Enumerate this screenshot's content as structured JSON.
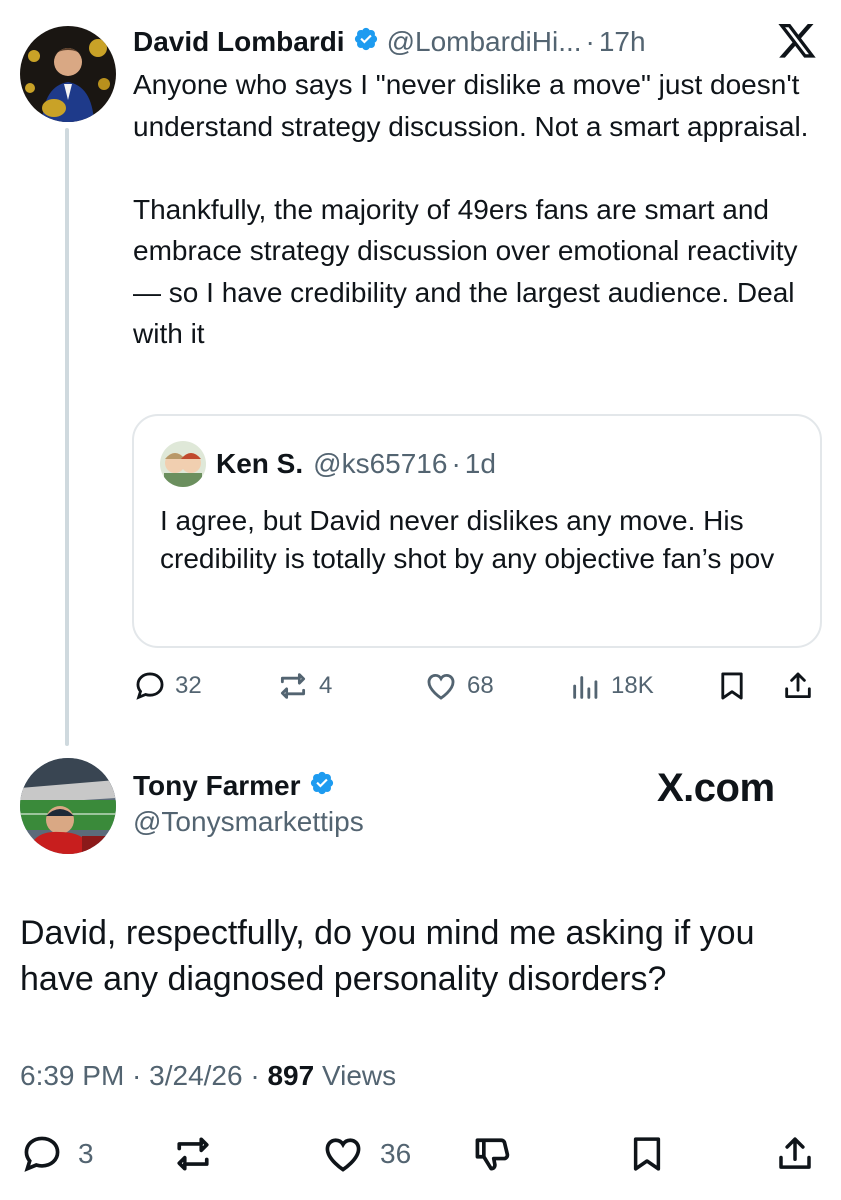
{
  "post1": {
    "author_name": "David Lombardi",
    "handle": "@LombardiHi...",
    "time": "17h",
    "paragraphs": [
      "Anyone who says I \"never dislike a move\" just doesn't understand strategy discussion. Not a smart appraisal.",
      "Thankfully, the majority of 49ers fans are smart and embrace strategy discussion over emotional reactivity — so I have credibility and the largest audience. Deal with it"
    ],
    "quote": {
      "author_name": "Ken S.",
      "handle": "@ks65716",
      "time": "1d",
      "text": "I agree, but David never dislikes any move. His credibility is totally shot by any objective fan’s pov"
    },
    "stats": {
      "replies": "32",
      "reposts": "4",
      "likes": "68",
      "views": "18K"
    }
  },
  "post2": {
    "author_name": "Tony Farmer",
    "handle": "@Tonysmarkettips",
    "watermark": "X.com",
    "text": "David, respectfully, do you mind me asking if you have any diagnosed personality disorders?",
    "timestamp": "6:39 PM · 3/24/26 ·",
    "views_count": "897",
    "views_label": "Views",
    "stats": {
      "replies": "3",
      "likes": "36"
    }
  },
  "colors": {
    "text": "#0f1419",
    "secondary": "#536471",
    "verified": "#1d9bf0",
    "border": "#e3e7ea",
    "thread_line": "#cfd9de"
  },
  "icons": [
    "x-logo-icon",
    "verified-icon",
    "reply-icon",
    "repost-icon",
    "like-icon",
    "views-icon",
    "bookmark-icon",
    "share-icon",
    "dislike-icon"
  ]
}
